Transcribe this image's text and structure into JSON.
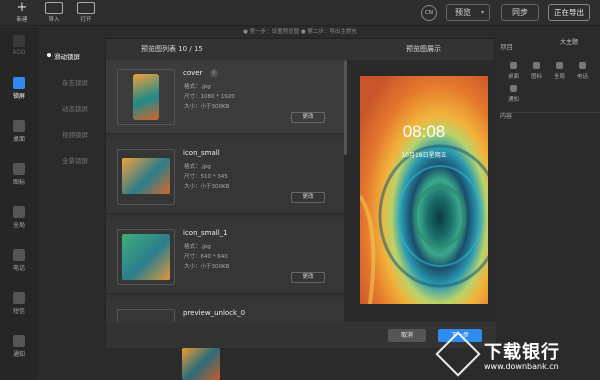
{
  "toolbar": {
    "new_label": "新建",
    "import_label": "导入",
    "open_label": "打开",
    "lang_label": "CN",
    "preview_label": "预览",
    "sync_label": "同步",
    "export_label": "正在导出"
  },
  "sidebar": {
    "items": [
      {
        "label": "AOD",
        "icon": "aod-icon"
      },
      {
        "label": "锁屏",
        "icon": "lock-icon"
      },
      {
        "label": "桌面",
        "icon": "desktop-icon"
      },
      {
        "label": "图标",
        "icon": "grid-icon"
      },
      {
        "label": "全局",
        "icon": "gear-icon"
      },
      {
        "label": "电话",
        "icon": "phone-icon"
      },
      {
        "label": "短信",
        "icon": "message-icon"
      },
      {
        "label": "通知",
        "icon": "bell-icon"
      }
    ]
  },
  "submenu": {
    "items": [
      "滑动锁屏",
      "杂志锁屏",
      "动态锁屏",
      "视频锁屏",
      "全景锁屏"
    ]
  },
  "steps": {
    "text": "● 第一步：设置预览图 ● 第二步：导出主题包"
  },
  "modal": {
    "list_title": "预览图列表 10 / 15",
    "preview_title": "预览图展示",
    "items": [
      {
        "name": "cover",
        "format": "格式：.jpg",
        "size": "尺寸：1080 * 1920",
        "filesize": "大小：小于300KB",
        "change": "更改"
      },
      {
        "name": "icon_small",
        "format": "格式：.jpg",
        "size": "尺寸：510 * 345",
        "filesize": "大小：小于300KB",
        "change": "更改"
      },
      {
        "name": "icon_small_1",
        "format": "格式：.jpg",
        "size": "尺寸：640 * 640",
        "filesize": "大小：小于300KB",
        "change": "更改"
      },
      {
        "name": "preview_unlock_0",
        "format": "",
        "size": "",
        "filesize": "",
        "change": ""
      }
    ],
    "info_glyph": "i",
    "clock": "08:08",
    "date": "10月18日星期五",
    "cancel": "取消",
    "next": "下一步"
  },
  "right_panel": {
    "label": "项目",
    "select": "大主题",
    "icons": [
      "桌面",
      "图标",
      "全局",
      "电话"
    ],
    "icon2": "通知",
    "content": "内容"
  },
  "watermark": {
    "title": "下载银行",
    "url": "www.downbank.cn"
  }
}
